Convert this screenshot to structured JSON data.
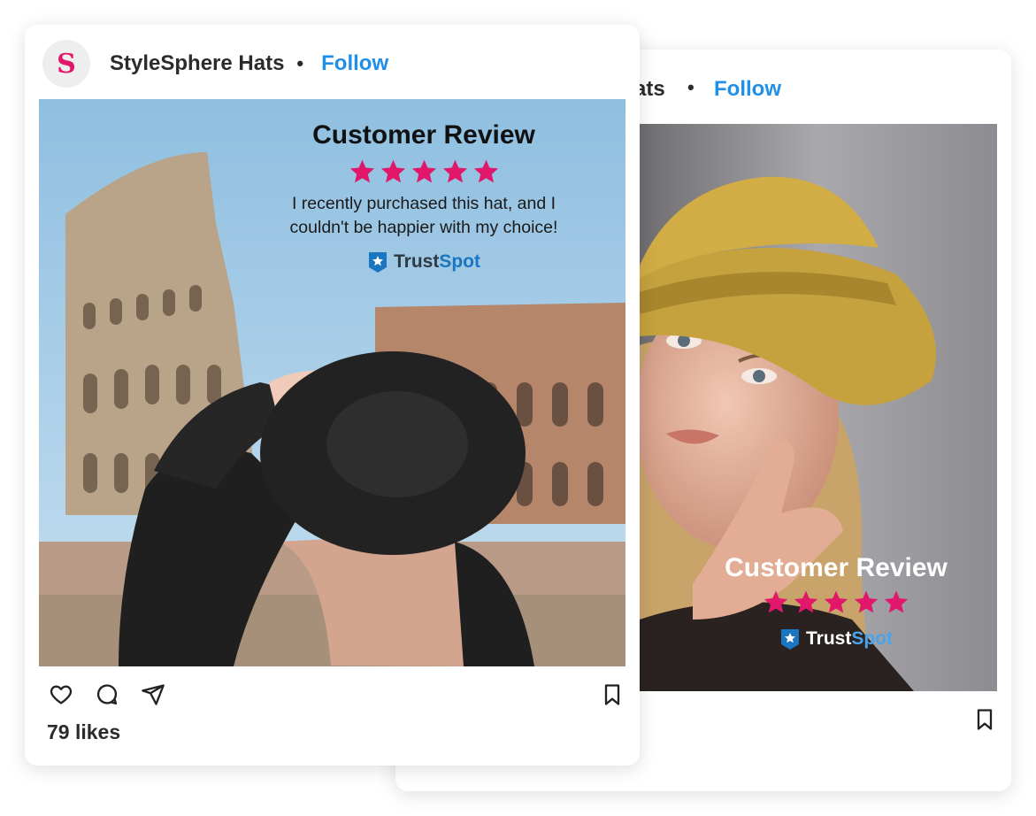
{
  "brand": {
    "accent": "#1f8fea",
    "star": "#e0176b",
    "trust_dark": "#2f3942",
    "trust_light": "#1b76c2"
  },
  "front_post": {
    "avatar_letter": "S",
    "account_name": "StyleSphere Hats",
    "separator": "•",
    "follow_label": "Follow",
    "review": {
      "title": "Customer Review",
      "rating": 5,
      "quote_line1": "I recently purchased this hat, and I",
      "quote_line2": "couldn't be happier with my choice!",
      "trust_part1": "Trust",
      "trust_part2": "Spot"
    },
    "actions": [
      "heart-icon",
      "comment-icon",
      "share-icon",
      "bookmark-icon"
    ],
    "likes": "79 likes"
  },
  "back_post": {
    "account_name_partial": "ats",
    "separator": "•",
    "follow_label": "Follow",
    "review": {
      "title": "Customer Review",
      "rating": 5,
      "trust_part1": "Trust",
      "trust_part2": "Spot"
    },
    "actions": [
      "bookmark-icon"
    ]
  }
}
